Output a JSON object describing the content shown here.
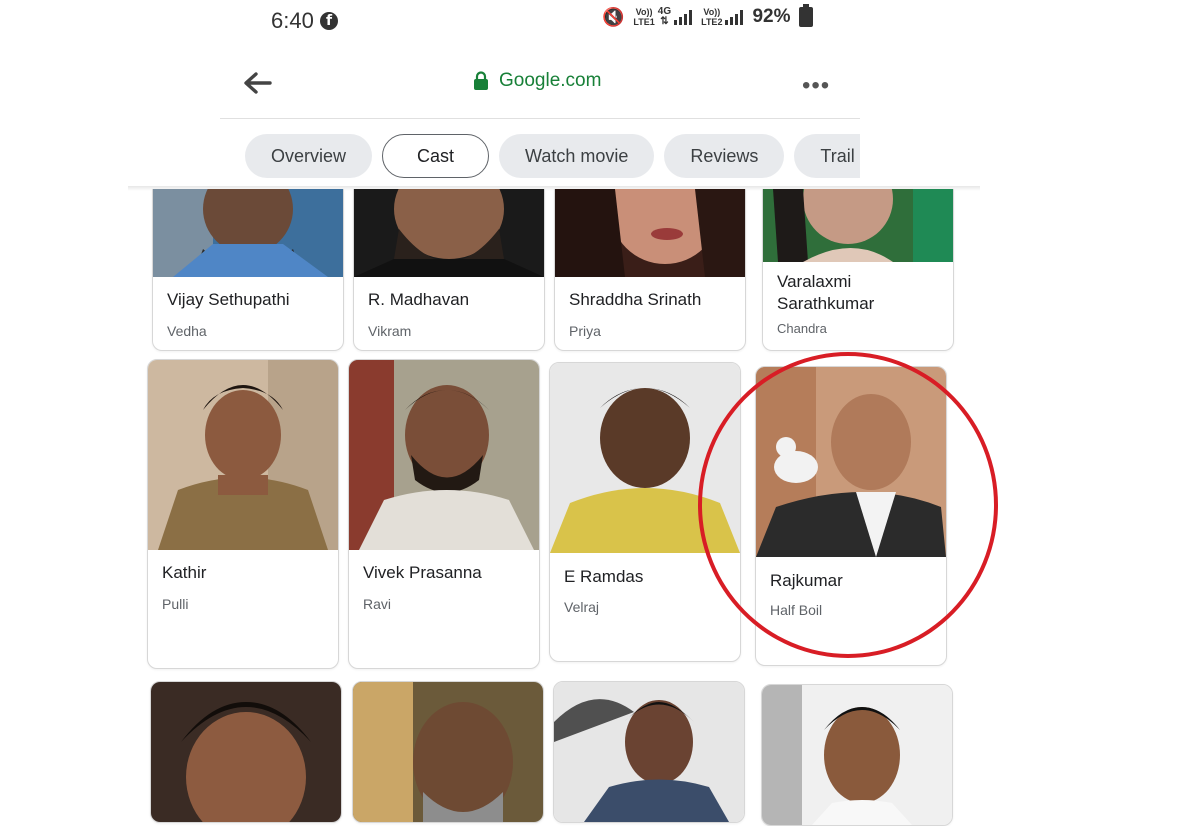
{
  "status": {
    "time": "6:40",
    "network1": [
      "Vo))",
      "LTE1"
    ],
    "network_type": "4G",
    "network2": [
      "Vo))",
      "LTE2"
    ],
    "battery": "92%"
  },
  "browser": {
    "url": "Google.com",
    "menu": "•••"
  },
  "tabs": [
    {
      "label": "Overview"
    },
    {
      "label": "Cast"
    },
    {
      "label": "Watch movie"
    },
    {
      "label": "Reviews"
    },
    {
      "label": "Trail"
    }
  ],
  "active_tab": "Cast",
  "cast": [
    {
      "name": "Vijay Sethupathi",
      "role": "Vedha"
    },
    {
      "name": "R. Madhavan",
      "role": "Vikram"
    },
    {
      "name": "Shraddha Srinath",
      "role": "Priya"
    },
    {
      "name": "Varalaxmi Sarathkumar",
      "role": "Chandra"
    },
    {
      "name": "Kathir",
      "role": "Pulli"
    },
    {
      "name": "Vivek Prasanna",
      "role": "Ravi"
    },
    {
      "name": "E Ramdas",
      "role": "Velraj"
    },
    {
      "name": "Rajkumar",
      "role": "Half Boil"
    }
  ],
  "colors": {
    "url_green": "#188038",
    "highlight_red": "#d81d25"
  }
}
